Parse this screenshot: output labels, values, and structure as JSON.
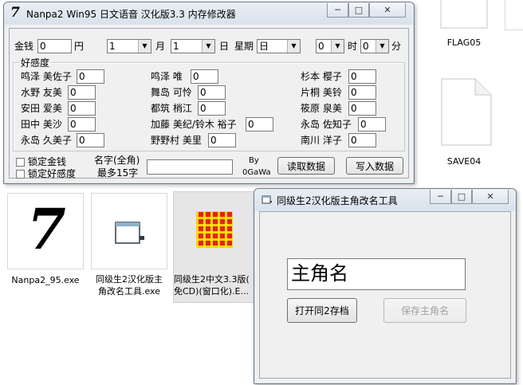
{
  "desktop": {
    "files": [
      {
        "label_lines": [
          "FLAG05"
        ]
      },
      {
        "label_lines": [
          "SAVE04"
        ]
      },
      {
        "label_lines": [
          "Nanpa2_95.exe"
        ]
      },
      {
        "label_lines": [
          "同级生2汉化版主",
          "角改名工具.exe"
        ]
      },
      {
        "label_lines": [
          "同级生2中文3.3版(",
          "免CD)(窗口化).E..."
        ]
      }
    ],
    "icon_glyph": "7"
  },
  "nanpa_window": {
    "title": "Nanpa2 Win95 日文语音 汉化版3.3 内存修改器",
    "logo_glyph": "7",
    "money": {
      "label": "金钱",
      "value": "0",
      "unit": "円"
    },
    "date": {
      "month_value": "1",
      "month_label": "月",
      "day_value": "1",
      "day_label": "日",
      "weekday_label": "星期",
      "weekday_value": "日",
      "hour_value": "0",
      "hour_label": "时",
      "minute_value": "0",
      "minute_label": "分"
    },
    "affection_group_label": "好感度",
    "girls": [
      {
        "name": "鸣泽 美佐子",
        "value": "0"
      },
      {
        "name": "鸣泽 唯",
        "value": "0"
      },
      {
        "name": "杉本 樱子",
        "value": "0"
      },
      {
        "name": "水野 友美",
        "value": "0"
      },
      {
        "name": "舞岛 可怜",
        "value": "0"
      },
      {
        "name": "片桐 美铃",
        "value": "0"
      },
      {
        "name": "安田 爱美",
        "value": "0"
      },
      {
        "name": "都筑 梢江",
        "value": "0"
      },
      {
        "name": "筱原 泉美",
        "value": "0"
      },
      {
        "name": "田中 美沙",
        "value": "0"
      },
      {
        "name": "加藤 美纪/铃木 裕子",
        "value": "0"
      },
      {
        "name": "永岛 佐知子",
        "value": "0"
      },
      {
        "name": "永岛 久美子",
        "value": "0"
      },
      {
        "name": "野野村 美里",
        "value": "0"
      },
      {
        "name": "南川 洋子",
        "value": "0"
      }
    ],
    "lock_money_label": "锁定金钱",
    "lock_affection_label": "锁定好感度",
    "name_label_line1": "名字(全角)",
    "name_label_line2": "最多15字",
    "name_value": "",
    "by_line1": "By",
    "by_line2": "0GaWa",
    "read_button": "读取数据",
    "write_button": "写入数据"
  },
  "rename_window": {
    "title": "同级生2汉化版主角改名工具",
    "name_value": "主角名",
    "open_button": "打开同2存档",
    "save_button": "保存主角名"
  }
}
